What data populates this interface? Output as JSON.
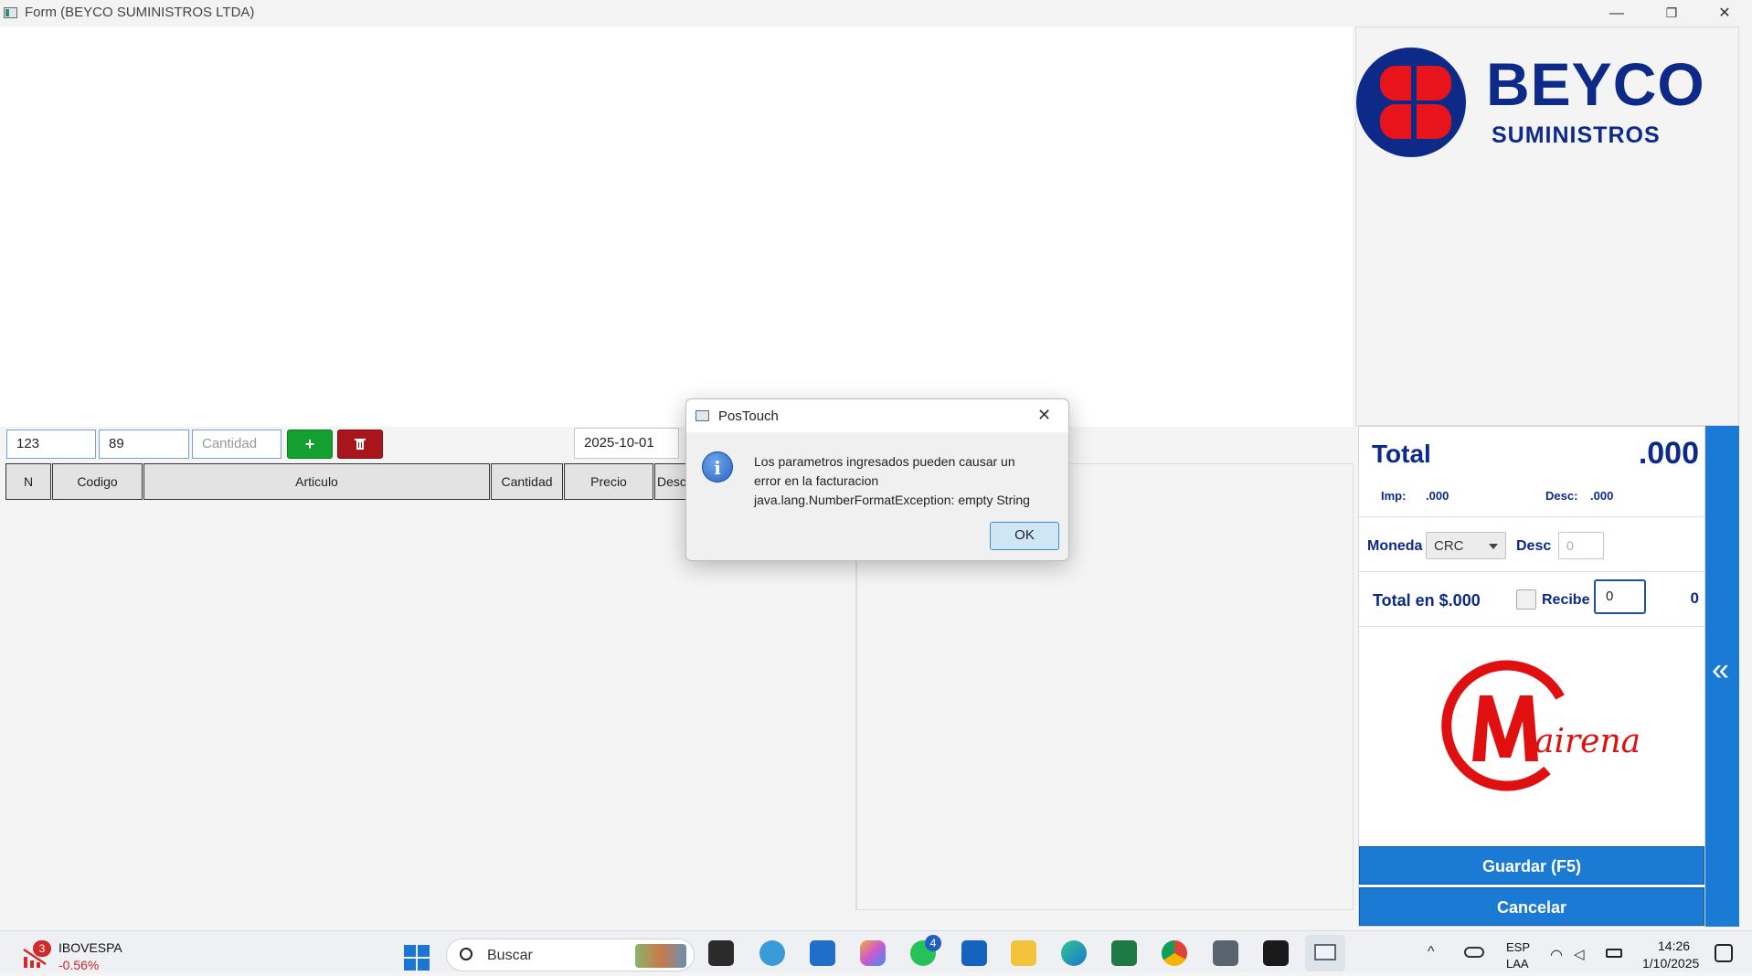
{
  "window": {
    "title": "Form (BEYCO SUMINISTROS LTDA)",
    "minimize_glyph": "—",
    "restore_glyph": "❐",
    "close_glyph": "✕"
  },
  "logo": {
    "brand": "BEYCO",
    "sub": "SUMINISTROS"
  },
  "entry": {
    "field1_value": "123",
    "field2_value": "89",
    "cantidad_placeholder": "Cantidad",
    "add_label": "+",
    "delete_icon": "trash-icon",
    "date_value": "2025-10-01"
  },
  "table": {
    "columns": [
      "N",
      "Codigo",
      "Articulo",
      "Cantidad",
      "Precio",
      "Desc"
    ]
  },
  "totals": {
    "total_label": "Total",
    "total_value": ".000",
    "imp_label": "Imp:",
    "imp_value": ".000",
    "desc_label": "Desc:",
    "desc_value": ".000",
    "moneda_label": "Moneda",
    "moneda_value": "CRC",
    "desc2_label": "Desc",
    "desc2_placeholder": "0",
    "total_en_label": "Total en $.000",
    "recibe_label": "Recibe",
    "recibe_value": "0",
    "change_value": "0",
    "collapse_glyph": "«",
    "guardar_label": "Guardar (F5)",
    "cancelar_label": "Cancelar"
  },
  "mairena_logo": {
    "text": "airena"
  },
  "dialog": {
    "title": "PosTouch",
    "message_line1": "Los parametros ingresados pueden causar un",
    "message_line2": "error en la facturacion",
    "message_line3": "java.lang.NumberFormatException: empty String",
    "ok_label": "OK",
    "info_glyph": "i"
  },
  "taskbar": {
    "widget_name": "IBOVESPA",
    "widget_value": "-0.56%",
    "widget_badge": "3",
    "search_label": "Buscar",
    "whatsapp_badge": "4",
    "language_line1": "ESP",
    "language_line2": "LAA",
    "time": "14:26",
    "date": "1/10/2025"
  },
  "colors": {
    "navy": "#0d2a88",
    "accent_blue": "#1a7ad4",
    "add_green": "#13a031",
    "delete_red": "#a8151b",
    "mairena_red": "#e01010"
  }
}
